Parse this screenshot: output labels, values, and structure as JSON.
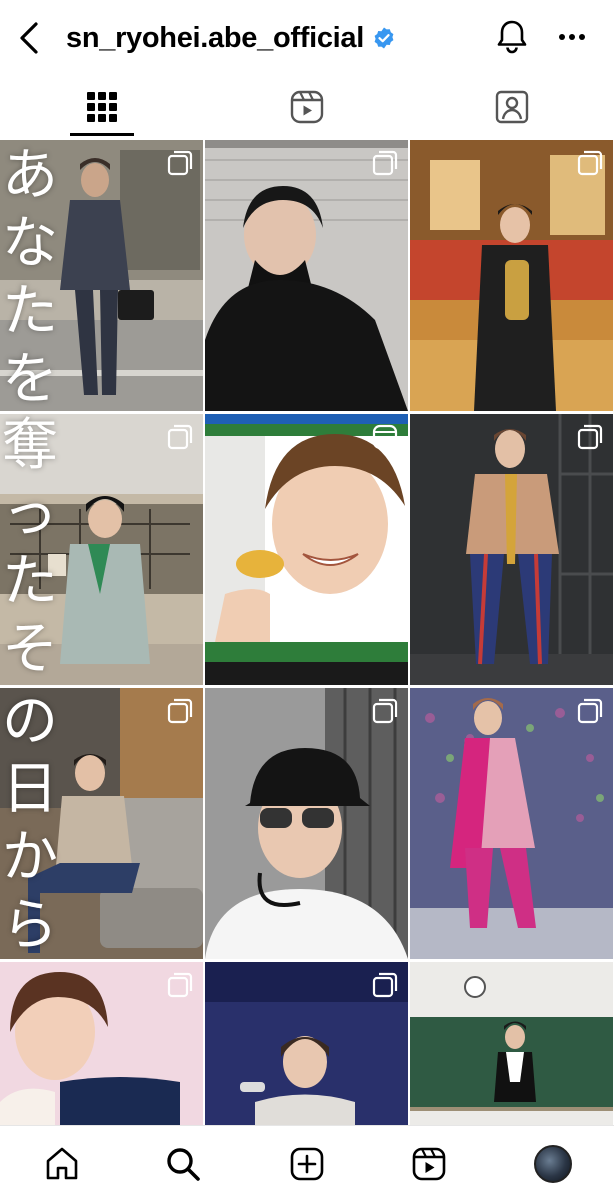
{
  "header": {
    "username": "sn_ryohei.abe_official",
    "icons": [
      "chevron-left-icon",
      "verified-badge-icon",
      "bell-icon",
      "more-icon"
    ],
    "verified_color": "#3897f0"
  },
  "tabs": [
    {
      "name": "posts",
      "icon": "grid-icon",
      "active": true
    },
    {
      "name": "reels",
      "icon": "reels-icon",
      "active": false
    },
    {
      "name": "tagged",
      "icon": "tagged-icon",
      "active": false
    }
  ],
  "overlay_text": {
    "col1": [
      "あ",
      "な",
      "た",
      "を",
      "奪",
      "っ",
      "た",
      "そ",
      "の",
      "日",
      "か",
      "ら"
    ]
  },
  "posts": [
    {
      "type": "multiple",
      "desc": "Man in grey suit walking with briefcase"
    },
    {
      "type": "multiple",
      "desc": "Black-clad performer covering mouth with glove"
    },
    {
      "type": "multiple",
      "desc": "Holding championship belt on TV set"
    },
    {
      "type": "multiple",
      "desc": "Light blue jacket with green scarf"
    },
    {
      "type": "reel",
      "desc": "Smiling with chip snack"
    },
    {
      "type": "multiple",
      "desc": "Patterned stage costume"
    },
    {
      "type": "multiple",
      "desc": "Seated on grey sofa"
    },
    {
      "type": "multiple",
      "desc": "Black cap and sunglasses with headset"
    },
    {
      "type": "multiple",
      "desc": "Pink and gold costume on stage"
    },
    {
      "type": "multiple",
      "desc": "Hugging pillow"
    },
    {
      "type": "multiple",
      "desc": "Singing with microphone"
    },
    {
      "type": "multiple",
      "desc": "Standing in classroom"
    }
  ],
  "bottom_nav": [
    "home-icon",
    "search-icon",
    "create-icon",
    "reels-icon",
    "profile-avatar"
  ]
}
